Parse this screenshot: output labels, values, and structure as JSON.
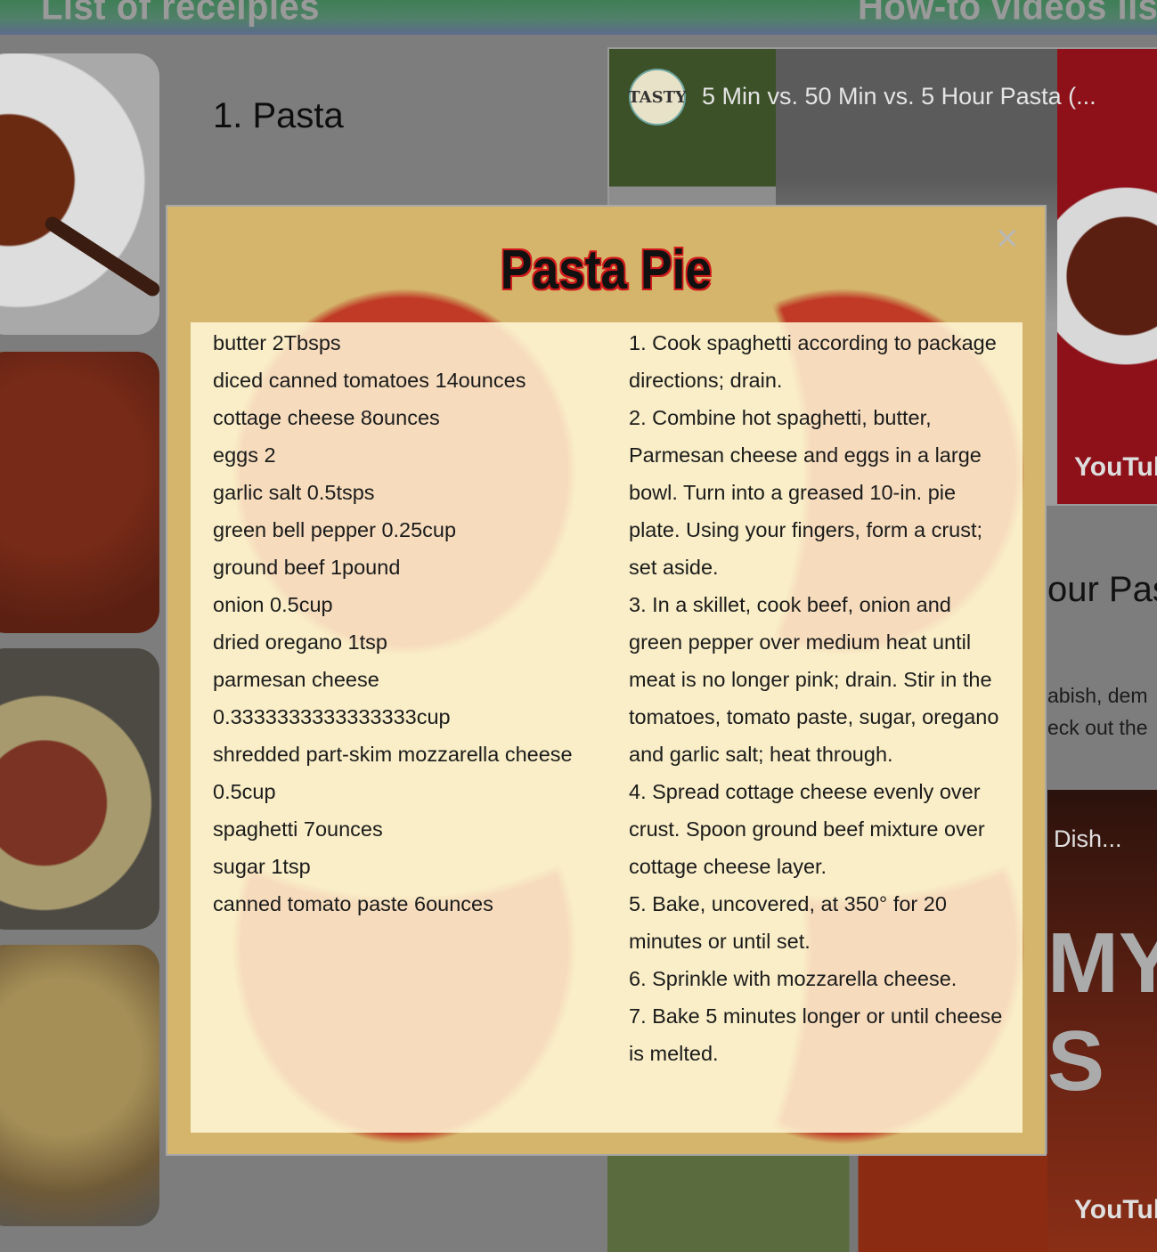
{
  "header": {
    "left_title": "List of receipies",
    "right_title": "How-to videos list"
  },
  "main": {
    "recipe_heading": "1. Pasta",
    "side_heading": "our Pas",
    "side_text_1": "abish, dem",
    "side_text_2": "eck out the"
  },
  "video1": {
    "channel": "TASTY",
    "title": "5 Min vs. 50 Min vs. 5 Hour Pasta (...",
    "platform": "YouTube"
  },
  "video2": {
    "title": "Dish...",
    "big_text": "MY\nS",
    "platform": "YouTube"
  },
  "modal": {
    "title": "Pasta Pie",
    "close_label": "×",
    "ingredients": [
      "butter 2Tbsps",
      "diced canned tomatoes 14ounces",
      "cottage cheese 8ounces",
      "eggs 2",
      "garlic salt 0.5tsps",
      "green bell pepper 0.25cup",
      "ground beef 1pound",
      "onion 0.5cup",
      "dried oregano 1tsp",
      "parmesan cheese 0.3333333333333333cup",
      "shredded part-skim mozzarella cheese 0.5cup",
      "spaghetti 7ounces",
      "sugar 1tsp",
      "canned tomato paste 6ounces"
    ],
    "steps": [
      "1. Cook spaghetti according to package directions; drain.",
      "2. Combine hot spaghetti, butter, Parmesan cheese and eggs in a large bowl. Turn into a greased 10-in. pie plate. Using your fingers, form a crust; set aside.",
      "3. In a skillet, cook beef, onion and green pepper over medium heat until meat is no longer pink; drain. Stir in the tomatoes, tomato paste, sugar, oregano and garlic salt; heat through.",
      "4. Spread cottage cheese evenly over crust. Spoon ground beef mixture over cottage cheese layer.",
      "5. Bake, uncovered, at 350° for 20 minutes or until set.",
      "6. Sprinkle with mozzarella cheese.",
      "7. Bake 5 minutes longer or until cheese is melted."
    ]
  }
}
